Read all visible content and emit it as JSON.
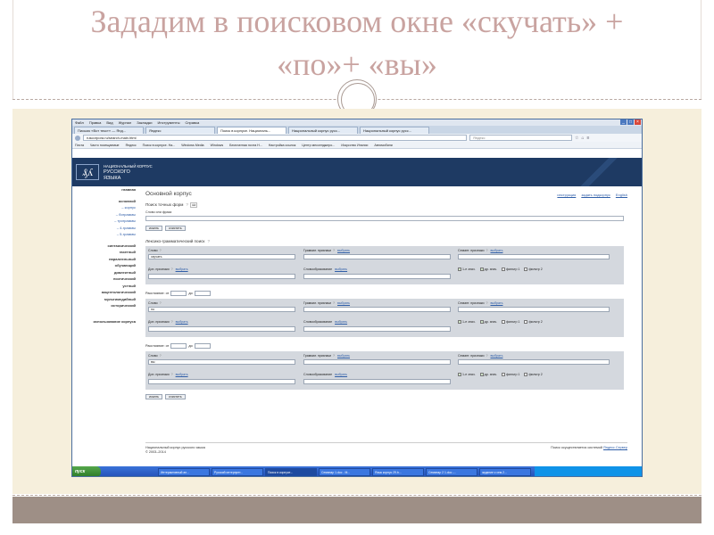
{
  "slide": {
    "title_line1": "Зададим в поисковом окне «скучать» +",
    "title_line2": "«по»+ «вы»"
  },
  "browser": {
    "menu": [
      "Файл",
      "Правка",
      "Вид",
      "Журнал",
      "Закладки",
      "Инструменты",
      "Справка"
    ],
    "tabs": [
      "Письмо «Вот текст» — Янд...",
      "Яндекс",
      "Поиск в корпусе. Националь...",
      "Национальный корпус русс...",
      "Национальный корпус русс..."
    ],
    "url": "ruscorpora.ru/search-main.html",
    "search_placeholder": "Яндекс",
    "bookmarks": [
      "Почта",
      "Часто посещаемые",
      "Яндекс",
      "Поиск в корпусе. На...",
      "Windows Media",
      "Windows",
      "Бесплатная почта H...",
      "Настройка ссылок",
      "Центр мессенджеро...",
      "Искусство Италии",
      "Автомобили"
    ]
  },
  "site": {
    "logo": "₰ʎ",
    "name1": "НАЦИОНАЛЬНЫЙ КОРПУС",
    "name2": "РУССКОГО",
    "name3": "ЯЗЫКА"
  },
  "sidebar": {
    "home": "главная",
    "main": "основной",
    "items": [
      "– корпус",
      "– биграммы",
      "– триграммы",
      "– 4-граммы",
      "– 5-граммы"
    ],
    "corpora": [
      "синтаксический",
      "газетный",
      "параллельный",
      "обучающий",
      "диалектный",
      "поэтический",
      "устный",
      "акцентологический",
      "мультимедийный",
      "исторический"
    ],
    "usage": "использование корпуса"
  },
  "main": {
    "title": "Основной корпус",
    "top_links": [
      "инструкция",
      "задать подкорпус",
      "English"
    ],
    "exact_title": "Поиск точных форм",
    "exact_field_label": "Слово или фраза",
    "search_btn": "искать",
    "clear_btn": "очистить",
    "lexgram_title": "Лексико-грамматический поиск",
    "labels": {
      "word": "Слово",
      "gram": "Граммат. признаки",
      "sem": "Семант. признаки",
      "extra": "Доп. признаки",
      "wordform": "Словообразование",
      "choose": "выбрать",
      "distance": "Расстояние: от",
      "to": "до",
      "check1": "1-е знач.",
      "check2": "др. знач.",
      "check3": "фильтр 1",
      "check4": "фильтр 2"
    },
    "words": [
      "скучать",
      "по",
      "вы"
    ],
    "footer_left1": "Национальный корпус русского языка",
    "footer_left2": "© 2003–2014",
    "footer_right": "Поиск осуществляется системой",
    "footer_link": "Яндекс.Сервер"
  },
  "taskbar": {
    "start": "пуск",
    "items": [
      "Интерактивный ан...",
      "Русский интерпрет...",
      "Поиск в корпусе...",
      "Семинар 1.doc - M...",
      "Язык корпус 29.b...",
      "Семинар 2 1.doc -...",
      "задание к сем.2..."
    ]
  }
}
